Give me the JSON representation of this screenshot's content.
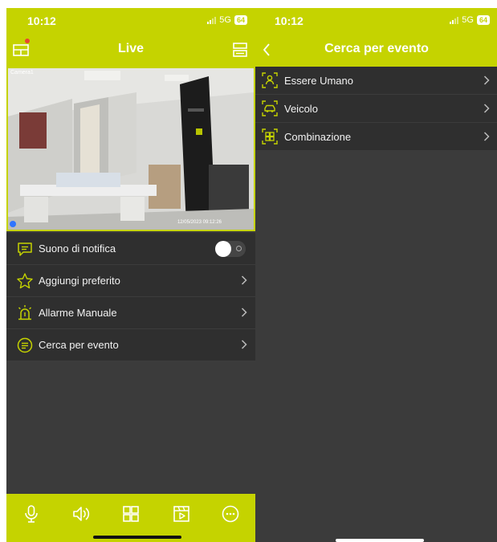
{
  "left": {
    "status": {
      "time": "10:12",
      "network": "5G",
      "battery": "64"
    },
    "nav": {
      "title": "Live"
    },
    "camera": {
      "label": "Camera1",
      "timestamp": "12/05/2023 09:12:26"
    },
    "menu": [
      {
        "label": "Suono di notifica",
        "icon": "message-icon",
        "control": "toggle",
        "toggle_on": false
      },
      {
        "label": "Aggiungi preferito",
        "icon": "star-icon",
        "control": "chevron"
      },
      {
        "label": "Allarme Manuale",
        "icon": "alarm-icon",
        "control": "chevron"
      },
      {
        "label": "Cerca per evento",
        "icon": "search-event-icon",
        "control": "chevron"
      }
    ],
    "tabbar": [
      "microphone-icon",
      "speaker-icon",
      "grid-icon",
      "playback-icon",
      "more-icon"
    ]
  },
  "right": {
    "status": {
      "time": "10:12",
      "network": "5G",
      "battery": "64"
    },
    "nav": {
      "title": "Cerca per evento"
    },
    "menu": [
      {
        "label": "Essere Umano",
        "icon": "human-detect-icon"
      },
      {
        "label": "Veicolo",
        "icon": "vehicle-detect-icon"
      },
      {
        "label": "Combinazione",
        "icon": "combination-icon"
      }
    ]
  },
  "colors": {
    "accent": "#c5d300",
    "background": "#3b3b3b",
    "row": "#2f2f2f"
  }
}
